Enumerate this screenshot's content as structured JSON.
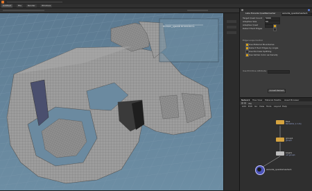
{
  "tabs": [
    {
      "label": "Untitled"
    },
    {
      "label": "File"
    },
    {
      "label": "Render"
    },
    {
      "label": "Windows"
    }
  ],
  "viewport": {
    "camera_label": "Persp",
    "display_label": "No cam",
    "info_panel_title": "",
    "info_panel_text": "ocean_quadremesher1"
  },
  "params": {
    "node_type": "Labs Exoside QuadRemesher",
    "node_name": "exoside_quadremesher1",
    "rows": [
      {
        "label": "Target Quad Count",
        "value": "5000"
      },
      {
        "label": "Adaptive Size",
        "value": "50"
      },
      {
        "label": "Adaptive Quad",
        "value": ""
      },
      {
        "label": "Detect Hard Edges",
        "value": ""
      }
    ],
    "checks": [
      {
        "label": "Use Material Boundaries",
        "on": true
      },
      {
        "label": "Detect Hard Edges by Angle",
        "on": true
      },
      {
        "label": "Use Normals Splitting",
        "on": false
      },
      {
        "label": "Use Vertex Color as Density",
        "on": true
      }
    ],
    "section_label": "Edge Loops Control",
    "section2_label": "Use Primitive Attribute",
    "button_label": "Convert Remesh"
  },
  "network": {
    "tabs": [
      "Network",
      "Tree View",
      "Material Palette",
      "Asset Browser"
    ],
    "menu": [
      "Add",
      "Edit",
      "Go",
      "View",
      "Tools",
      "Layout",
      "Help"
    ],
    "path": "obj",
    "nodes": [
      {
        "name": "file1",
        "sub": "Remesher_1.1.obj",
        "color": "#d6a440"
      },
      {
        "name": "group1",
        "sub": "group1",
        "color": "#d6a440"
      },
      {
        "name": "blast1",
        "sub": "not group1",
        "color": "#bdbdbd"
      },
      {
        "name": "exoside_quadremesher1",
        "sub": "",
        "color": "#4a53b8"
      }
    ]
  },
  "colors": {
    "background": "#5e7f96",
    "grid": "#7c98ab",
    "mesh": "#9a9a9a",
    "accent": "#d6a11c"
  },
  "icons": [
    "gear-icon",
    "lock-icon",
    "help-icon",
    "eye-icon",
    "camera-icon"
  ]
}
